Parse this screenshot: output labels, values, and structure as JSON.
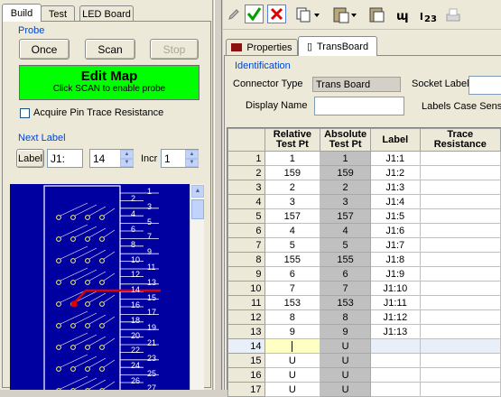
{
  "left": {
    "tabs": [
      "Build",
      "Test",
      "LED Board"
    ],
    "probe_title": "Probe",
    "once_label": "Once",
    "scan_label": "Scan",
    "stop_label": "Stop",
    "edit_map_title": "Edit Map",
    "edit_map_sub": "Click SCAN to enable probe",
    "acquire_label": "Acquire Pin Trace Resistance",
    "next_label_title": "Next Label",
    "label_button": "Label",
    "label_prefix": "J1:",
    "label_number": "14",
    "incr_label": "Incr",
    "incr_value": "1",
    "pin_labels": [
      "1",
      "2",
      "3",
      "4",
      "5",
      "6",
      "7",
      "8",
      "9",
      "10",
      "11",
      "12",
      "13",
      "14",
      "15",
      "16",
      "17",
      "18",
      "19",
      "20",
      "21",
      "22",
      "23",
      "24",
      "25",
      "26",
      "27"
    ]
  },
  "right": {
    "tabs": [
      "Properties",
      "TransBoard"
    ],
    "identification_title": "Identification",
    "connector_type_label": "Connector Type",
    "connector_type_value": "Trans Board",
    "socket_label": "Socket Label",
    "display_name_label": "Display Name",
    "labels_case_label": "Labels Case Sensit",
    "columns": [
      "Relative Test Pt",
      "Absolute Test Pt",
      "Label",
      "Trace Resistance"
    ],
    "rows": [
      {
        "n": "1",
        "rel": "1",
        "abs": "1",
        "label": "J1:1"
      },
      {
        "n": "2",
        "rel": "159",
        "abs": "159",
        "label": "J1:2"
      },
      {
        "n": "3",
        "rel": "2",
        "abs": "2",
        "label": "J1:3"
      },
      {
        "n": "4",
        "rel": "3",
        "abs": "3",
        "label": "J1:4"
      },
      {
        "n": "5",
        "rel": "157",
        "abs": "157",
        "label": "J1:5"
      },
      {
        "n": "6",
        "rel": "4",
        "abs": "4",
        "label": "J1:6"
      },
      {
        "n": "7",
        "rel": "5",
        "abs": "5",
        "label": "J1:7"
      },
      {
        "n": "8",
        "rel": "155",
        "abs": "155",
        "label": "J1:8"
      },
      {
        "n": "9",
        "rel": "6",
        "abs": "6",
        "label": "J1:9"
      },
      {
        "n": "10",
        "rel": "7",
        "abs": "7",
        "label": "J1:10"
      },
      {
        "n": "11",
        "rel": "153",
        "abs": "153",
        "label": "J1:11"
      },
      {
        "n": "12",
        "rel": "8",
        "abs": "8",
        "label": "J1:12"
      },
      {
        "n": "13",
        "rel": "9",
        "abs": "9",
        "label": "J1:13"
      },
      {
        "n": "14",
        "rel": "",
        "abs": "U",
        "label": ""
      },
      {
        "n": "15",
        "rel": "U",
        "abs": "U",
        "label": ""
      },
      {
        "n": "16",
        "rel": "U",
        "abs": "U",
        "label": ""
      },
      {
        "n": "17",
        "rel": "U",
        "abs": "U",
        "label": ""
      }
    ]
  },
  "colors": {
    "edit_map_bg": "#00ff00",
    "board_bg": "#0000a0",
    "trace_red": "#e00000"
  }
}
